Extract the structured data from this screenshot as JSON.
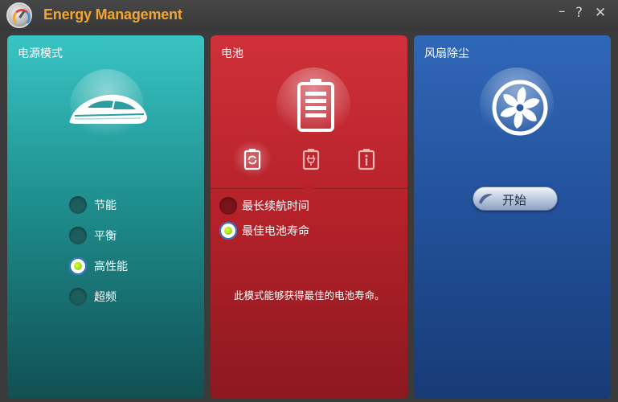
{
  "app": {
    "title": "Energy Management",
    "logo_icon": "gauge-icon"
  },
  "window": {
    "minimize": "–",
    "help": "?",
    "close": "✕"
  },
  "power_mode": {
    "title": "电源模式",
    "icon": "train-icon",
    "options": [
      {
        "label": "节能",
        "selected": false
      },
      {
        "label": "平衡",
        "selected": false
      },
      {
        "label": "高性能",
        "selected": true
      },
      {
        "label": "超频",
        "selected": false
      }
    ],
    "color": "#2aa8a8"
  },
  "battery": {
    "title": "电池",
    "icon": "battery-icon",
    "tabs": [
      {
        "icon": "battery-refresh-icon",
        "active": true
      },
      {
        "icon": "battery-plug-icon",
        "active": false
      },
      {
        "icon": "battery-info-icon",
        "active": false
      }
    ],
    "options": [
      {
        "label": "最长续航时间",
        "selected": false
      },
      {
        "label": "最佳电池寿命",
        "selected": true
      }
    ],
    "description": "此模式能够获得最佳的电池寿命。",
    "color": "#c1272f"
  },
  "fan": {
    "title": "风扇除尘",
    "icon": "fan-icon",
    "start_label": "开始",
    "color": "#2a5ca8"
  }
}
